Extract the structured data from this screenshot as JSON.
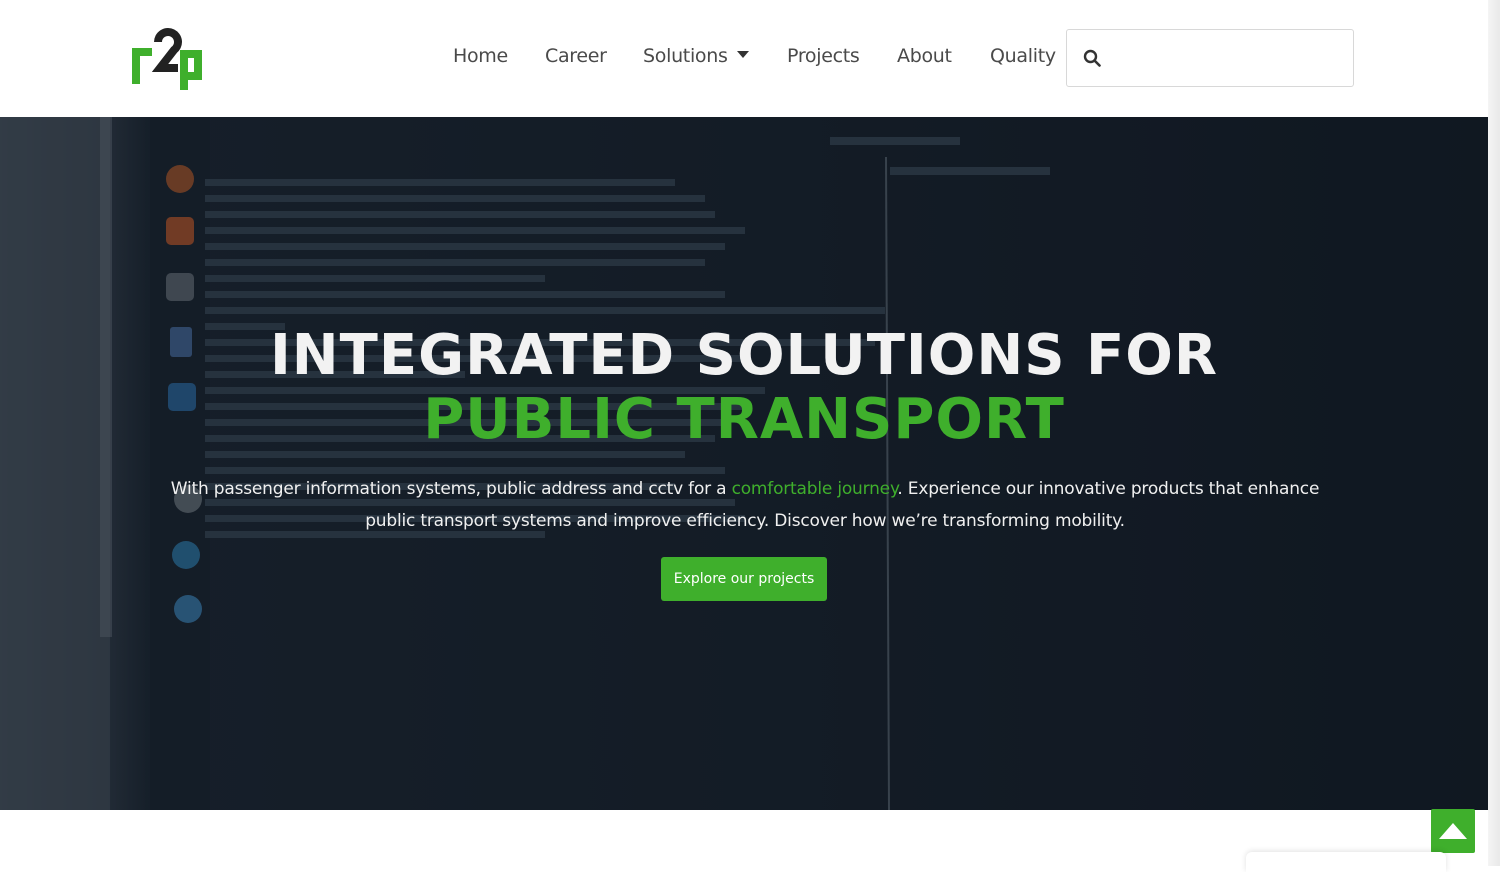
{
  "header": {
    "logo_text": "r2p",
    "nav": [
      {
        "label": "Home"
      },
      {
        "label": "Career"
      },
      {
        "label": "Solutions"
      },
      {
        "label": "Projects"
      },
      {
        "label": "About"
      },
      {
        "label": "Quality"
      }
    ],
    "search": {
      "placeholder": "",
      "value": "",
      "icon": "search-icon"
    }
  },
  "hero": {
    "title_line1": "INTEGRATED SOLUTIONS FOR",
    "title_line2": "PUBLIC TRANSPORT",
    "desc_part1": "With passenger information systems, public address and cctv for a ",
    "desc_accent": "comfortable journey",
    "desc_part2": ". Experience our innovative products that enhance public transport systems and improve efficiency. Discover how we’re transforming mobility.",
    "cta_label": "Explore our projects"
  },
  "colors": {
    "accent": "#3faf2c",
    "hero_dark": "#16202b",
    "nav_text": "#4a4a4a"
  },
  "scroll_top": {
    "icon": "arrow-up-icon"
  }
}
